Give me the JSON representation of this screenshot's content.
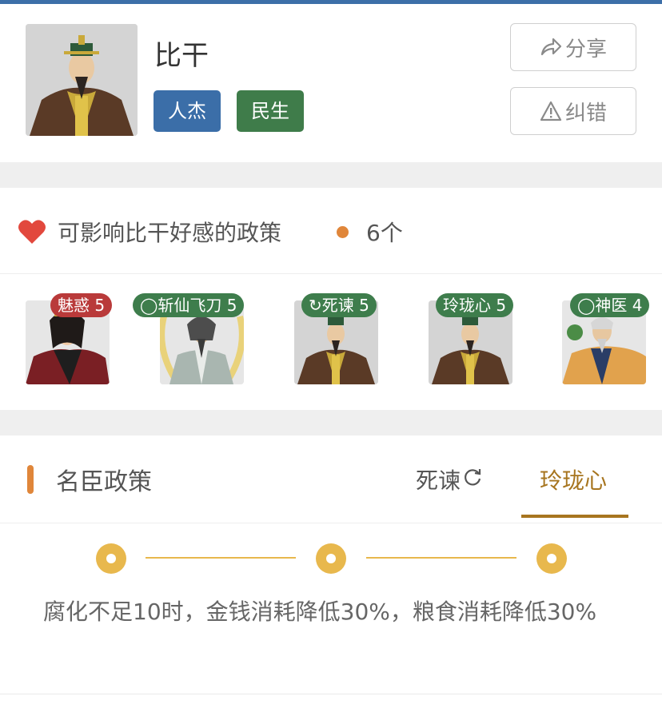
{
  "header": {
    "name": "比干",
    "tags": [
      "人杰",
      "民生"
    ],
    "share_label": "分享",
    "report_label": "纠错",
    "share_icon": "share-icon",
    "report_icon": "warning-icon"
  },
  "favor": {
    "title": "可影响比干好感的政策",
    "count": "6个",
    "heart_icon": "heart-icon",
    "heart_color": "#e2483d",
    "items": [
      {
        "label": "魅惑 5",
        "badge_color": "#b93a3a"
      },
      {
        "label": "◯斩仙飞刀 5",
        "badge_color": "#3e7d4c"
      },
      {
        "label": "↻死谏 5",
        "badge_color": "#3e7d4c"
      },
      {
        "label": "玲珑心 5",
        "badge_color": "#3e7d4c"
      },
      {
        "label": "◯神医 4",
        "badge_color": "#3e7d4c"
      }
    ]
  },
  "ministers": {
    "title": "名臣政策",
    "tabs": [
      {
        "label": "死谏",
        "icon": "refresh-icon"
      },
      {
        "label": "玲珑心",
        "selected": true
      }
    ],
    "description": "腐化不足10时，金钱消耗降低30%，粮食消耗降低30%"
  },
  "colors": {
    "top_bar": "#3d6fa8",
    "tag_blue": "#3b6ea8",
    "tag_green": "#3f7c4a",
    "accent_orange": "#e0863a",
    "accent_gold": "#a7751f",
    "level_dot": "#e8b84d"
  }
}
